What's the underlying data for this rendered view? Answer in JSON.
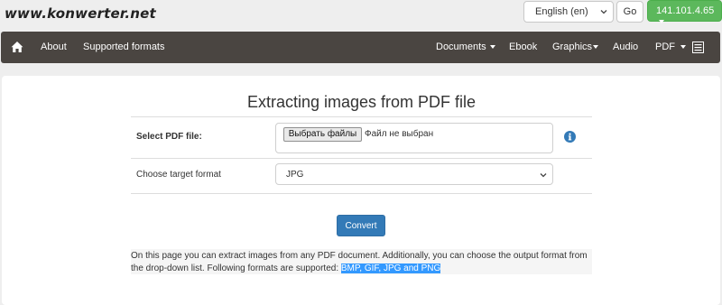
{
  "header": {
    "logo": "www.konwerter.net",
    "language_value": "English (en)",
    "go_label": "Go",
    "ip_label": "141.101.4.65"
  },
  "nav": {
    "about": "About",
    "supported_formats": "Supported formats",
    "documents": "Documents",
    "ebook": "Ebook",
    "graphics": "Graphics",
    "audio": "Audio",
    "pdf": "PDF"
  },
  "main": {
    "title": "Extracting images from PDF file",
    "select_label": "Select PDF file:",
    "file_button": "Выбрать файлы",
    "file_status": "Файл не выбран",
    "target_label": "Choose target format",
    "target_value": "JPG",
    "convert_label": "Convert",
    "description_text": "On this page you can extract images from any PDF document. Additionally, you can choose the output format from the drop-down list. Following formats are supported: ",
    "description_formats": "BMP, GIF, JPG and PNG"
  },
  "colors": {
    "navbar": "#4a4541",
    "ip_button": "#5cb85c",
    "convert_button": "#337ab7",
    "info_icon": "#337ab7",
    "highlight": "#3399ff"
  },
  "icons": [
    "home-icon",
    "list-icon",
    "info-icon",
    "chevron-down-icon"
  ]
}
